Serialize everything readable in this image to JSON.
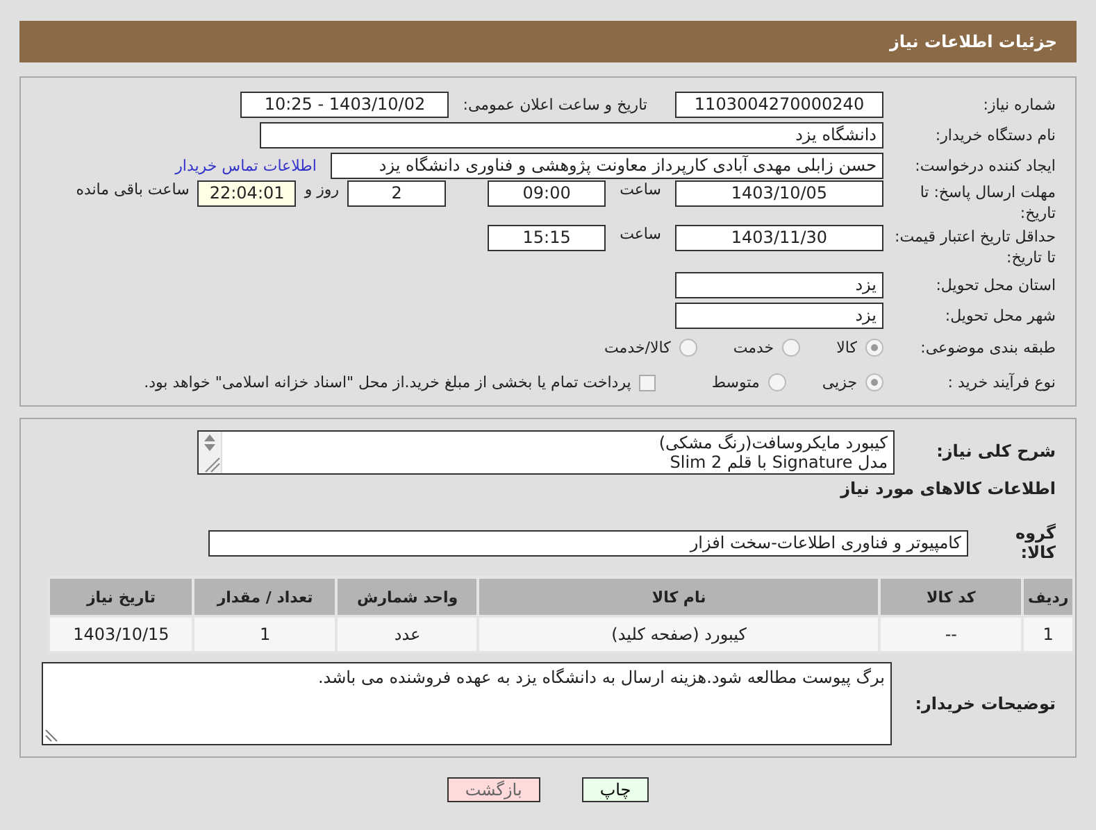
{
  "header": {
    "title": "جزئیات اطلاعات نیاز"
  },
  "need_number": {
    "label": "شماره نیاز:",
    "value": "1103004270000240"
  },
  "announce": {
    "label": "تاریخ و ساعت اعلان عمومی:",
    "value": "1403/10/02 - 10:25"
  },
  "buyer_org": {
    "label": "نام دستگاه خریدار:",
    "value": "دانشگاه یزد"
  },
  "requester": {
    "label": "ایجاد کننده درخواست:",
    "value": "حسن زابلی مهدی آبادی کارپرداز معاونت پژوهشی و فناوری دانشگاه یزد",
    "link": "اطلاعات تماس خریدار"
  },
  "reply_deadline": {
    "label": "مهلت ارسال پاسخ: تا تاریخ:",
    "date": "1403/10/05",
    "time_label": "ساعت",
    "time": "09:00",
    "days": "2",
    "days_label": "روز و",
    "remaining": "22:04:01",
    "remaining_label": "ساعت باقی مانده"
  },
  "price_validity": {
    "label": "حداقل تاریخ اعتبار قیمت: تا تاریخ:",
    "date": "1403/11/30",
    "time_label": "ساعت",
    "time": "15:15"
  },
  "province": {
    "label": "استان محل تحویل:",
    "value": "یزد"
  },
  "city": {
    "label": "شهر محل تحویل:",
    "value": "یزد"
  },
  "category": {
    "label": "طبقه بندی موضوعی:",
    "options": [
      {
        "label": "کالا",
        "selected": true
      },
      {
        "label": "خدمت",
        "selected": false
      },
      {
        "label": "کالا/خدمت",
        "selected": false
      }
    ]
  },
  "process": {
    "label": "نوع فرآیند خرید :",
    "options": [
      {
        "label": "جزیی",
        "selected": true
      },
      {
        "label": "متوسط",
        "selected": false
      }
    ],
    "payment": {
      "label": "پرداخت تمام یا بخشی از مبلغ خرید.از محل \"اسناد خزانه اسلامی\" خواهد بود.",
      "checked": false
    }
  },
  "description": {
    "label": "شرح کلی نیاز:",
    "value": "کیبورد مایکروسافت(رنگ مشکی)\nمدل Signature با قلم Slim 2"
  },
  "goods_heading": "اطلاعات کالاهای مورد نیاز",
  "group": {
    "label": "گروه کالا:",
    "value": "کامپیوتر و فناوری اطلاعات-سخت افزار"
  },
  "table": {
    "columns": [
      "ردیف",
      "کد کالا",
      "نام کالا",
      "واحد شمارش",
      "تعداد / مقدار",
      "تاریخ نیاز"
    ],
    "rows": [
      [
        "1",
        "--",
        "کیبورد (صفحه کلید)",
        "عدد",
        "1",
        "1403/10/15"
      ]
    ]
  },
  "buyer_notes": {
    "label": "توضیحات خریدار:",
    "value": "برگ پیوست مطالعه شود.هزینه ارسال به دانشگاه یزد به عهده فروشنده می باشد."
  },
  "buttons": [
    {
      "label": "چاپ",
      "kind": "print"
    },
    {
      "label": "بازگشت",
      "kind": "back"
    }
  ]
}
